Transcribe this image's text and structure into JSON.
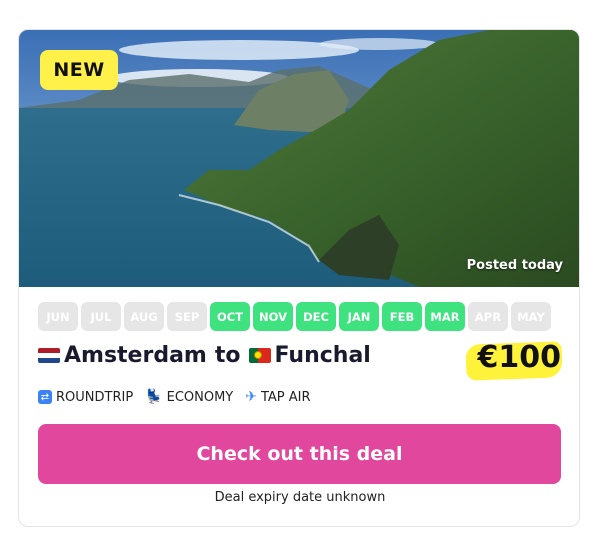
{
  "badge": {
    "label": "NEW"
  },
  "hero": {
    "posted_label": "Posted today"
  },
  "months": [
    {
      "label": "JUN",
      "active": false
    },
    {
      "label": "JUL",
      "active": false
    },
    {
      "label": "AUG",
      "active": false
    },
    {
      "label": "SEP",
      "active": false
    },
    {
      "label": "OCT",
      "active": true
    },
    {
      "label": "NOV",
      "active": true
    },
    {
      "label": "DEC",
      "active": true
    },
    {
      "label": "JAN",
      "active": true
    },
    {
      "label": "FEB",
      "active": true
    },
    {
      "label": "MAR",
      "active": true
    },
    {
      "label": "APR",
      "active": false
    },
    {
      "label": "MAY",
      "active": false
    }
  ],
  "route": {
    "origin": "Amsterdam",
    "connector": "to",
    "destination": "Funchal",
    "origin_flag": "netherlands-flag-icon",
    "destination_flag": "portugal-flag-icon"
  },
  "price": {
    "label": "€100"
  },
  "meta": {
    "trip_type": "ROUNDTRIP",
    "cabin": "ECONOMY",
    "airline": "TAP AIR"
  },
  "cta": {
    "label": "Check out this deal"
  },
  "expiry": {
    "label": "Deal expiry date unknown"
  },
  "colors": {
    "new_badge": "#fff04a",
    "month_active": "#3ee27f",
    "month_inactive": "#e6e6e6",
    "price_highlight": "#fff23a",
    "cta": "#e2479e"
  }
}
